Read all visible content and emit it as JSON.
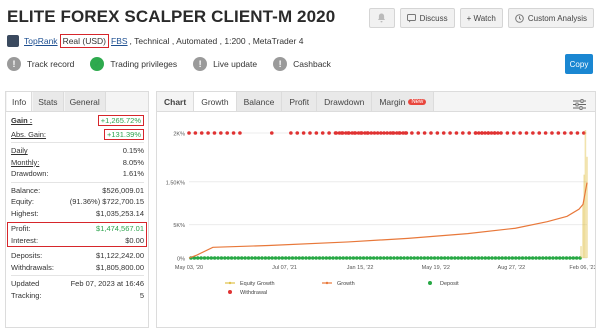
{
  "header": {
    "title": "ELITE FOREX SCALPER CLIENT-M 2020",
    "buttons": {
      "discuss": "Discuss",
      "watch": "+ Watch",
      "analysis": "Custom Analysis"
    },
    "meta": {
      "user": "TopRank",
      "account_type": "Real (USD)",
      "broker": "FBS",
      "details": ", Technical , Automated , 1:200 , MetaTrader 4"
    }
  },
  "badges": [
    {
      "label": "Track record",
      "icon": "exclamation-icon",
      "color": "#9a9a9a"
    },
    {
      "label": "Trading privileges",
      "icon": "check-icon",
      "color": "#2eaa4e"
    },
    {
      "label": "Live update",
      "icon": "exclamation-icon",
      "color": "#9a9a9a"
    },
    {
      "label": "Cashback",
      "icon": "exclamation-icon",
      "color": "#9a9a9a"
    }
  ],
  "copy_label": "Copy",
  "left_tabs": [
    "Info",
    "Stats",
    "General"
  ],
  "stats": {
    "gain_label": "Gain :",
    "gain_value": "+1,265.72%",
    "abs_gain_label": "Abs. Gain:",
    "abs_gain_value": "+131.39%",
    "daily_label": "Daily",
    "daily_value": "0.15%",
    "monthly_label": "Monthly:",
    "monthly_value": "8.05%",
    "drawdown_label": "Drawdown:",
    "drawdown_value": "1.61%",
    "balance_label": "Balance:",
    "balance_value": "$526,009.01",
    "equity_label": "Equity:",
    "equity_value": "(91.36%) $722,700.15",
    "highest_label": "Highest:",
    "highest_value": "$1,035,253.14",
    "profit_label": "Profit:",
    "profit_value": "$1,474,567.01",
    "interest_label": "Interest:",
    "interest_value": "$0.00",
    "deposits_label": "Deposits:",
    "deposits_value": "$1,122,242.00",
    "withdrawals_label": "Withdrawals:",
    "withdrawals_value": "$1,805,800.00",
    "updated_label": "Updated",
    "updated_value": "Feb 07, 2023 at 16:46",
    "tracking_label": "Tracking:",
    "tracking_value": "5"
  },
  "main_tabs": [
    "Chart",
    "Growth",
    "Balance",
    "Profit",
    "Drawdown",
    "Margin"
  ],
  "new_badge": "New",
  "chart_data": {
    "type": "line",
    "y_ticks": [
      "0%",
      "5K%",
      "1.50K%",
      "2K%"
    ],
    "x_ticks": [
      "May 03, '20",
      "Jul 07, '21",
      "Jan 15, '22",
      "May 19, '22",
      "Aug 27, '22",
      "Feb 06, '23"
    ],
    "legend": [
      "Equity Growth",
      "Growth",
      "Deposit",
      "Withdrawal"
    ],
    "colors": {
      "growth": "#e8783a",
      "equity": "#e0c14a",
      "deposit": "#27a844",
      "withdrawal": "#e03232"
    },
    "series": [
      {
        "name": "Growth",
        "x": [
          0,
          0.02,
          0.06,
          0.2,
          0.4,
          0.55,
          0.7,
          0.82,
          0.9,
          0.95,
          0.98,
          0.99,
          1.0
        ],
        "y": [
          0,
          50,
          180,
          210,
          270,
          330,
          410,
          500,
          610,
          700,
          820,
          900,
          1265.72
        ]
      },
      {
        "name": "Equity Growth",
        "x": [
          0.985,
          0.99,
          0.993,
          0.996,
          1.0
        ],
        "y": [
          200,
          900,
          1400,
          2150,
          1700
        ]
      }
    ]
  }
}
